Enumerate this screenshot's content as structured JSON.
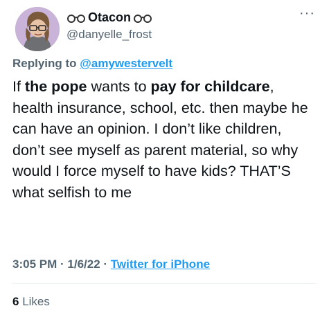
{
  "author": {
    "display_name": "Otacon",
    "handle": "@danyelle_frost",
    "name_decoration_icon": "glasses-emoji"
  },
  "reply": {
    "prefix": "Replying to",
    "to_handle": "@amywestervelt"
  },
  "tweet": {
    "segments": [
      {
        "text": "If ",
        "bold": false
      },
      {
        "text": "the pope",
        "bold": true
      },
      {
        "text": " wants to ",
        "bold": false
      },
      {
        "text": "pay for childcare",
        "bold": true
      },
      {
        "text": ", health insurance, school, etc. then maybe he can have an opinion. I don’t like children, don’t see myself as parent material, so why would I force myself to have kids? THAT’S what selfish to me",
        "bold": false
      }
    ]
  },
  "meta": {
    "time": "3:05 PM",
    "separator": "·",
    "date": "1/6/22",
    "source": "Twitter for iPhone"
  },
  "engagement": {
    "likes_count": "6",
    "likes_label": "Likes"
  },
  "more_label": "···",
  "colors": {
    "text": "#0f1419",
    "muted": "#536471",
    "link": "#1d9bf0",
    "avatar_bg": "#c9b3d8"
  }
}
